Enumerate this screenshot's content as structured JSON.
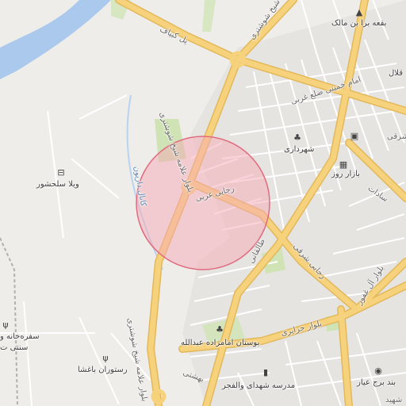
{
  "map": {
    "colors": {
      "background": "#efedea",
      "river": "#aac9ec",
      "park": "#cfe3b4",
      "primary_road": "#f7d27d",
      "primary_road_casing": "#e2b85a",
      "minor_road": "#ffffff",
      "urban": "#e4e2df",
      "radius_fill": "#f6a9b6",
      "radius_stroke": "#e06b7f",
      "railway": "#b0b0b0"
    },
    "labels": {
      "baqe": "بقعه برا بن مالک",
      "pol_kabaf": "پل کبیاف",
      "sheikh_shushtari": "شیخ شوشتری",
      "imam_khomeini": "امام خمینی ضلع غربی",
      "sharqi_top": "شرقی",
      "istiqlal": "قلال",
      "shahrdari": "شهرداری",
      "bazar_roz": "بازار روز",
      "sadat": "سادات",
      "blvd_allameh": "بلوار علامه شیخ شوشتری",
      "villa": "ویلا سلحشور",
      "canal": "کانال داریون",
      "rajai_gharbi": "رجایی غربی",
      "taleghani": "طالقانی",
      "rajai_sharqi": "رجایی شرقی",
      "blvd_algh": "بلوار آل غفور",
      "safarkhaneh": "سفره‌خانه و",
      "sonnati": "سنتی ت",
      "bustan": "بوستان امامزاده عبدالله",
      "blvd_jazayeri": "بلوار جزایری",
      "restaurant": "رستوران باغشا",
      "blvd_allameh_south": "بلوار علامه شیخ شوشتری",
      "beheshti": "بهشتی",
      "madreseh": "مدرسه شهدای والفجر",
      "band_borj": "بند برج عیار",
      "shahid": "شهید"
    },
    "icons": {
      "baqe": "mosque-icon",
      "shahrdari": "tree-icon",
      "bazar_roz": "shopping-bag-icon",
      "bazar_roz2": "shopping-cart-icon",
      "villa": "hotel-bed-icon",
      "safarkhaneh": "restaurant-icon",
      "restaurant": "restaurant-icon",
      "bustan": "tree-icon",
      "madreseh": "school-icon",
      "band_borj": "camera-icon"
    }
  }
}
